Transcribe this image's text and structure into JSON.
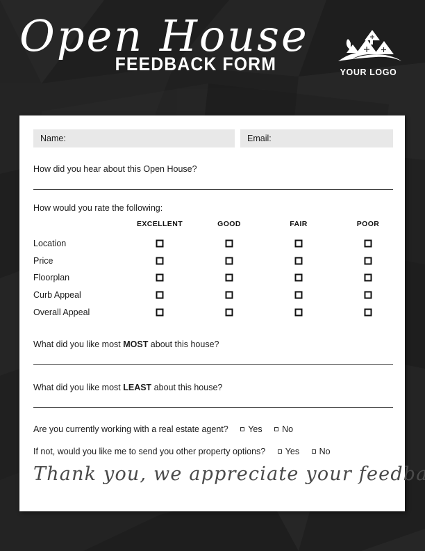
{
  "header": {
    "title_script": "Open House",
    "title_sub": "FEEDBACK FORM",
    "logo_text": "YOUR LOGO",
    "logo_icon": "house-roofs-logo-icon",
    "bg_color": "#232323",
    "text_color": "#ffffff"
  },
  "form": {
    "name_label": "Name:",
    "email_label": "Email:",
    "field_bg": "#e8e8e8",
    "q_hear": "How did you hear about this Open House?",
    "q_rate": "How would you rate the following:",
    "rating_columns": [
      "EXCELLENT",
      "GOOD",
      "FAIR",
      "POOR"
    ],
    "rating_rows": [
      "Location",
      "Price",
      "Floorplan",
      "Curb Appeal",
      "Overall Appeal"
    ],
    "q_most_pre": "What did you like most ",
    "q_most_bold": "MOST",
    "q_most_post": " about this house?",
    "q_least_pre": "What did you like most ",
    "q_least_bold": "LEAST",
    "q_least_post": " about this house?",
    "q_agent": "Are you currently working with a real estate agent?",
    "q_options": "If not, would you like me to send you other property options?",
    "yes_label": "Yes",
    "no_label": "No"
  },
  "footer": {
    "thanks": "Thank you, we appreciate your feedback!",
    "thanks_color": "#4a4a4a"
  }
}
